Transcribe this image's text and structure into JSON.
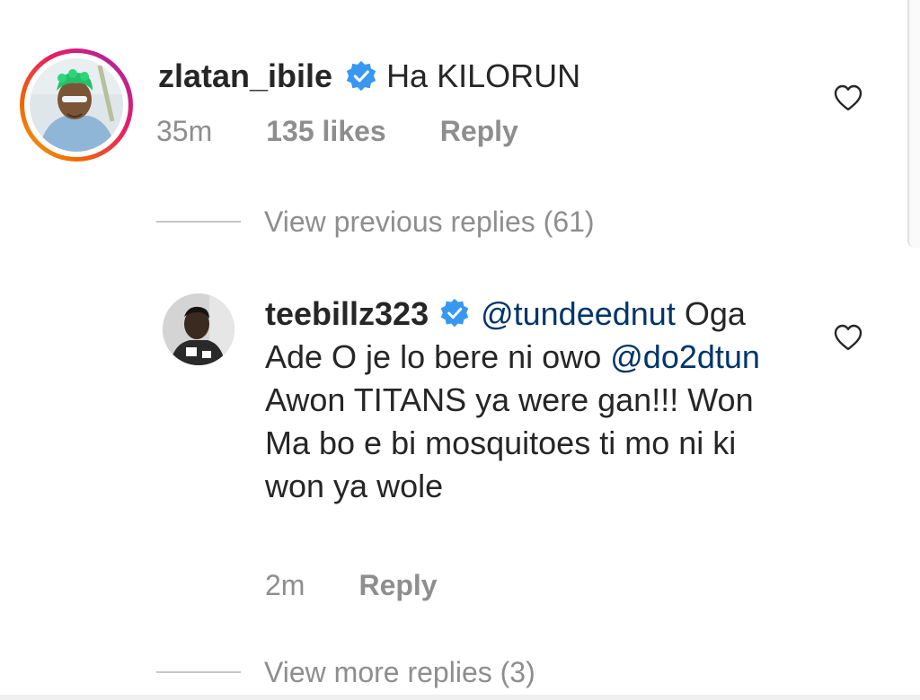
{
  "colors": {
    "text": "#262626",
    "secondary": "#8e8e8e",
    "mention": "#003569",
    "verified": "#3897f0"
  },
  "comments": [
    {
      "username": "zlatan_ibile",
      "verified": true,
      "text": "Ha KILORUN",
      "time": "35m",
      "likes": "135 likes",
      "reply_label": "Reply",
      "like_icon": "heart-outline-icon",
      "story_ring": true
    }
  ],
  "view_previous_replies": "View previous replies (61)",
  "reply": {
    "username": "teebillz323",
    "verified": true,
    "mention_1": "@tundeednut",
    "text_1": "Oga Ade O je lo bere ni owo",
    "mention_2": "@do2dtun",
    "text_2": "Awon TITANS ya were gan!!! Won Ma bo e bi mosquitoes ti mo ni ki won ya wole",
    "time": "2m",
    "reply_label": "Reply",
    "like_icon": "heart-outline-icon"
  },
  "view_more_replies": "View more replies (3)"
}
